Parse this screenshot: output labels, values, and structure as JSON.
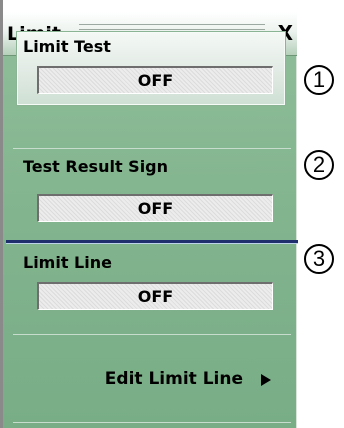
{
  "panel": {
    "title": "Limit",
    "close_label": "X",
    "limit_test": {
      "label": "Limit Test",
      "value": "OFF"
    },
    "test_result_sign": {
      "label": "Test Result Sign",
      "value": "OFF"
    },
    "limit_line": {
      "label": "Limit Line",
      "value": "OFF"
    },
    "edit_limit_line": {
      "label": "Edit Limit Line",
      "icon": "triangle-right-icon"
    }
  },
  "callouts": [
    "1",
    "2",
    "3"
  ]
}
